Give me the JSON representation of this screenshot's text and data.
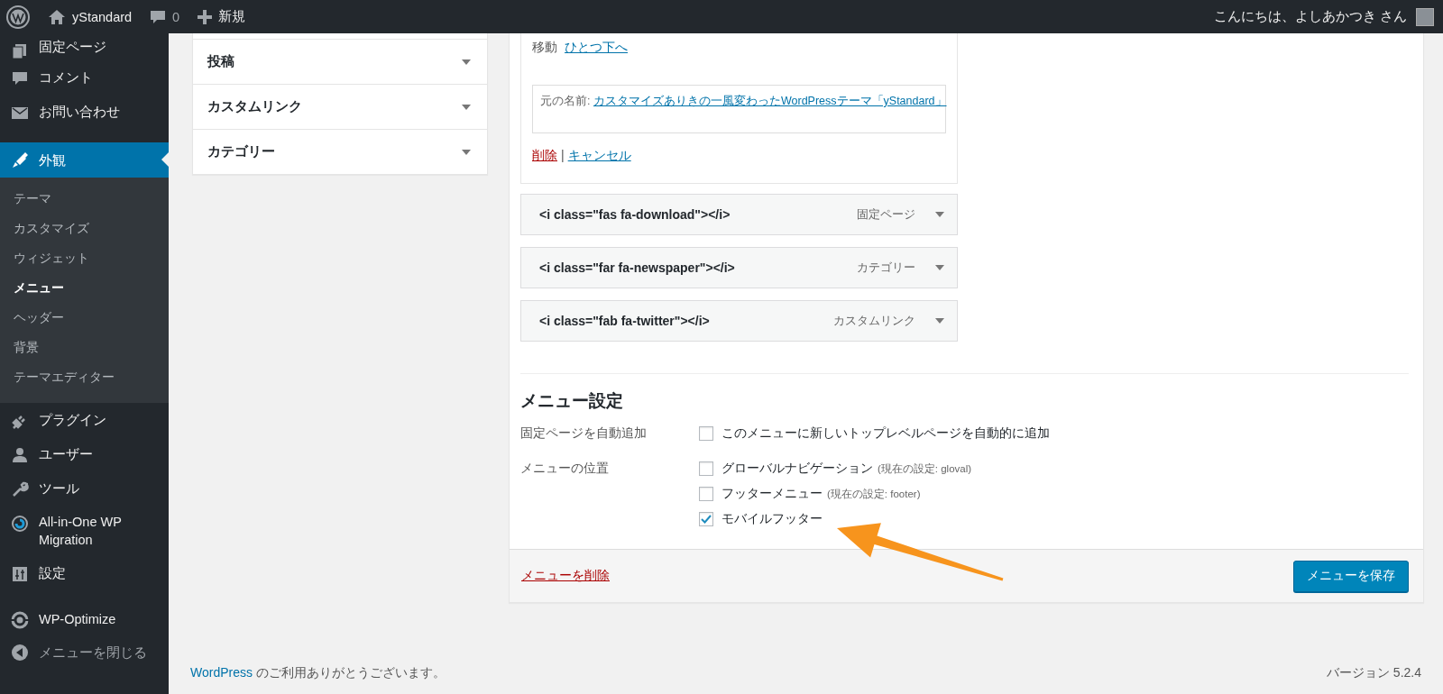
{
  "admin_bar": {
    "site_name": "yStandard",
    "comment_count": "0",
    "new_label": "新規",
    "greeting": "こんにちは、よしあかつき さん"
  },
  "sidebar": {
    "groups": [
      {
        "items": [
          {
            "label": "固定ページ",
            "selected": false
          },
          {
            "label": "コメント",
            "selected": false
          },
          {
            "label": "お問い合わせ",
            "selected": false
          }
        ]
      },
      {
        "items": [
          {
            "label": "外観",
            "selected": true,
            "children": [
              {
                "label": "テーマ",
                "selected": false
              },
              {
                "label": "カスタマイズ",
                "selected": false
              },
              {
                "label": "ウィジェット",
                "selected": false
              },
              {
                "label": "メニュー",
                "selected": true
              },
              {
                "label": "ヘッダー",
                "selected": false
              },
              {
                "label": "背景",
                "selected": false
              },
              {
                "label": "テーマエディター",
                "selected": false
              }
            ]
          },
          {
            "label": "プラグイン",
            "selected": false
          },
          {
            "label": "ユーザー",
            "selected": false
          },
          {
            "label": "ツール",
            "selected": false
          },
          {
            "label": "All-in-One WP Migration",
            "selected": false
          },
          {
            "label": "設定",
            "selected": false
          }
        ]
      },
      {
        "items": [
          {
            "label": "WP-Optimize",
            "selected": false
          }
        ]
      }
    ],
    "collapse_label": "メニューを閉じる"
  },
  "add_items": [
    {
      "label": "投稿"
    },
    {
      "label": "カスタムリンク"
    },
    {
      "label": "カテゴリー"
    }
  ],
  "menu_editor": {
    "open_item": {
      "move_label": "移動",
      "move_link": "ひとつ下へ",
      "original_label": "元の名前:",
      "original_link": "カスタマイズありきの一風変わったWordPressテーマ「yStandard」",
      "remove_link": "削除",
      "separator": "|",
      "cancel_link": "キャンセル"
    },
    "items": [
      {
        "title": "<i class=\"fas fa-download\"></i>",
        "type_label": "固定ページ"
      },
      {
        "title": "<i class=\"far fa-newspaper\"></i>",
        "type_label": "カテゴリー"
      },
      {
        "title": "<i class=\"fab fa-twitter\"></i>",
        "type_label": "カスタムリンク"
      }
    ],
    "settings": {
      "title": "メニュー設定",
      "rows": [
        {
          "label": "固定ページを自動追加",
          "options": [
            {
              "label": "このメニューに新しいトップレベルページを自動的に追加",
              "checked": false
            }
          ]
        },
        {
          "label": "メニューの位置",
          "options": [
            {
              "label": "グローバルナビゲーション",
              "note": "(現在の設定: gloval)",
              "checked": false
            },
            {
              "label": "フッターメニュー",
              "note": "(現在の設定: footer)",
              "checked": false
            },
            {
              "label": "モバイルフッター",
              "checked": true
            }
          ]
        }
      ]
    },
    "delete_link": "メニューを削除",
    "save_button": "メニューを保存"
  },
  "footer": {
    "thanks_link": "WordPress",
    "thanks_text": "のご利用ありがとうございます。",
    "version": "バージョン 5.2.4"
  }
}
